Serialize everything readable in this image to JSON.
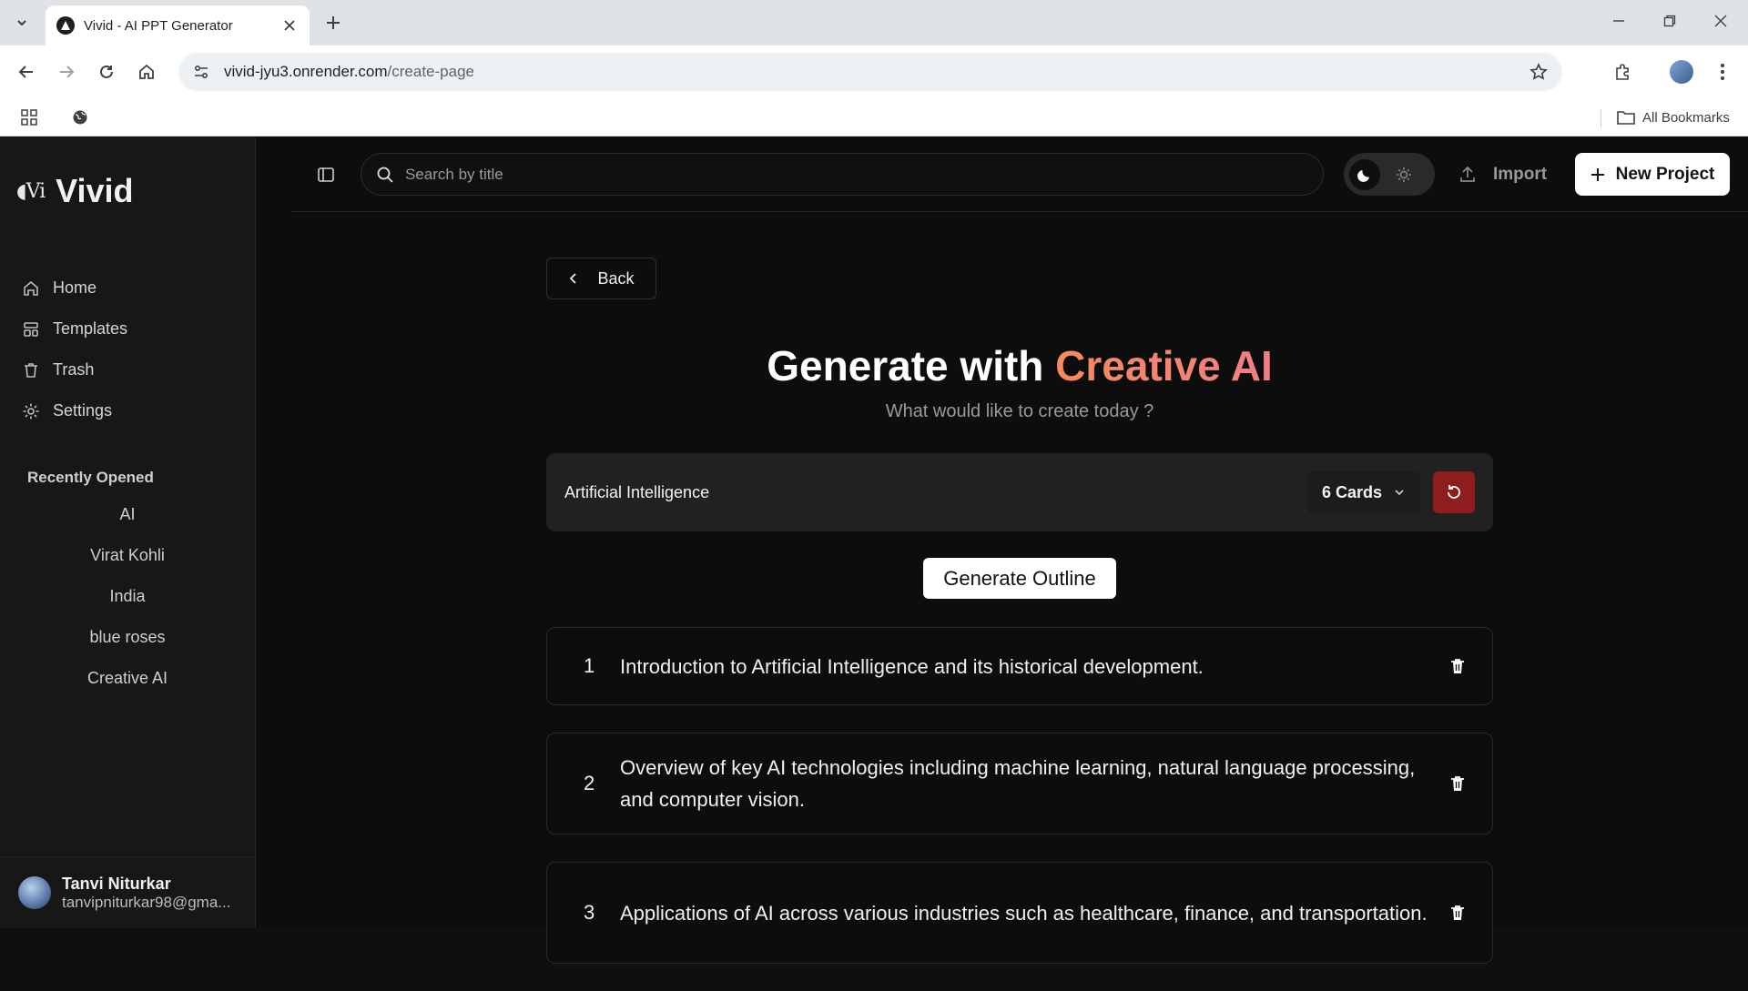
{
  "browser": {
    "tab_title": "Vivid - AI PPT Generator",
    "url_host": "vivid-jyu3.onrender.com",
    "url_path": "/create-page",
    "bookmarks_label": "All Bookmarks"
  },
  "sidebar": {
    "brand_mark": "◖Vi",
    "brand_name": "Vivid",
    "nav": [
      {
        "label": "Home",
        "icon": "home-icon"
      },
      {
        "label": "Templates",
        "icon": "templates-icon"
      },
      {
        "label": "Trash",
        "icon": "trash-icon"
      },
      {
        "label": "Settings",
        "icon": "gear-icon"
      }
    ],
    "recent_title": "Recently Opened",
    "recent": [
      "AI",
      "Virat Kohli",
      "India",
      "blue roses",
      "Creative AI"
    ],
    "user": {
      "name": "Tanvi Niturkar",
      "email": "tanvipniturkar98@gma..."
    }
  },
  "topbar": {
    "search_placeholder": "Search by title",
    "import_label": "Import",
    "new_project_label": "New Project"
  },
  "main": {
    "back_label": "Back",
    "headline_prefix": "Generate with ",
    "headline_accent": "Creative AI",
    "subhead": "What would like to create today ?",
    "prompt_value": "Artificial Intelligence",
    "cards_label": "6 Cards",
    "generate_label": "Generate Outline",
    "outline": [
      {
        "num": "1",
        "text": "Introduction to Artificial Intelligence and its historical development."
      },
      {
        "num": "2",
        "text": "Overview of key AI technologies including machine learning, natural language processing, and computer vision."
      },
      {
        "num": "3",
        "text": "Applications of AI across various industries such as healthcare, finance, and transportation."
      }
    ]
  },
  "colors": {
    "accent_start": "#f58a5c",
    "accent_end": "#ef7f86",
    "reset_button": "#8e1d1d",
    "background": "#0d0d0d"
  }
}
